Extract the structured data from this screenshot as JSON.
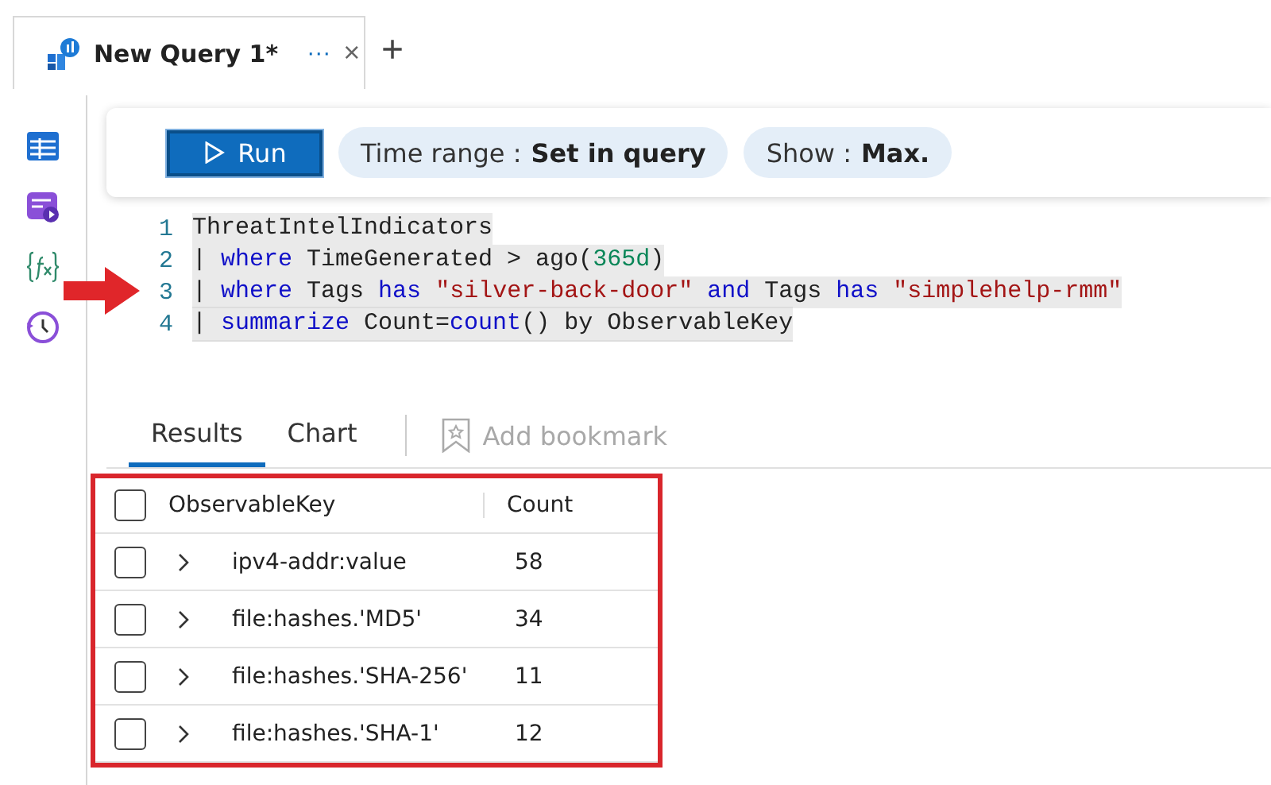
{
  "tab": {
    "title": "New Query 1*",
    "more": "···",
    "close": "×",
    "add": "+"
  },
  "toolbar": {
    "run": "Run",
    "time_range": {
      "label": "Time range :",
      "value": "Set in query"
    },
    "show": {
      "label": "Show :",
      "value": "Max."
    }
  },
  "editor": {
    "lines": [
      {
        "number": "1",
        "tokens": [
          {
            "kind": "plain",
            "text": "ThreatIntelIndicators"
          }
        ]
      },
      {
        "number": "2",
        "tokens": [
          {
            "kind": "plain",
            "text": "| "
          },
          {
            "kind": "keyword",
            "text": "where"
          },
          {
            "kind": "plain",
            "text": " TimeGenerated > ago("
          },
          {
            "kind": "number",
            "text": "365d"
          },
          {
            "kind": "plain",
            "text": ")"
          }
        ]
      },
      {
        "number": "3",
        "tokens": [
          {
            "kind": "plain",
            "text": "| "
          },
          {
            "kind": "keyword",
            "text": "where"
          },
          {
            "kind": "plain",
            "text": " Tags "
          },
          {
            "kind": "keyword",
            "text": "has"
          },
          {
            "kind": "string",
            "text": " \"silver-back-door\" "
          },
          {
            "kind": "keyword",
            "text": "and"
          },
          {
            "kind": "plain",
            "text": " Tags "
          },
          {
            "kind": "keyword",
            "text": "has"
          },
          {
            "kind": "string",
            "text": " \"simplehelp-rmm\""
          }
        ]
      },
      {
        "number": "4",
        "tokens": [
          {
            "kind": "plain",
            "text": "| "
          },
          {
            "kind": "keyword",
            "text": "summarize"
          },
          {
            "kind": "plain",
            "text": " Count="
          },
          {
            "kind": "keyword",
            "text": "count"
          },
          {
            "kind": "plain",
            "text": "() by ObservableKey"
          }
        ]
      }
    ]
  },
  "result_tabs": [
    {
      "label": "Results",
      "selected": true
    },
    {
      "label": "Chart",
      "selected": false
    }
  ],
  "bookmark": {
    "label": "Add bookmark",
    "disabled": true
  },
  "table": {
    "columns": [
      "ObservableKey",
      "Count"
    ],
    "header_checked": false,
    "rows": [
      {
        "key": "ipv4-addr:value",
        "count": "58",
        "checked": false,
        "expanded": false
      },
      {
        "key": "file:hashes.'MD5'",
        "count": "34",
        "checked": false,
        "expanded": false
      },
      {
        "key": "file:hashes.'SHA-256'",
        "count": "11",
        "checked": false,
        "expanded": false
      },
      {
        "key": "file:hashes.'SHA-1'",
        "count": "12",
        "checked": false,
        "expanded": false
      }
    ]
  }
}
